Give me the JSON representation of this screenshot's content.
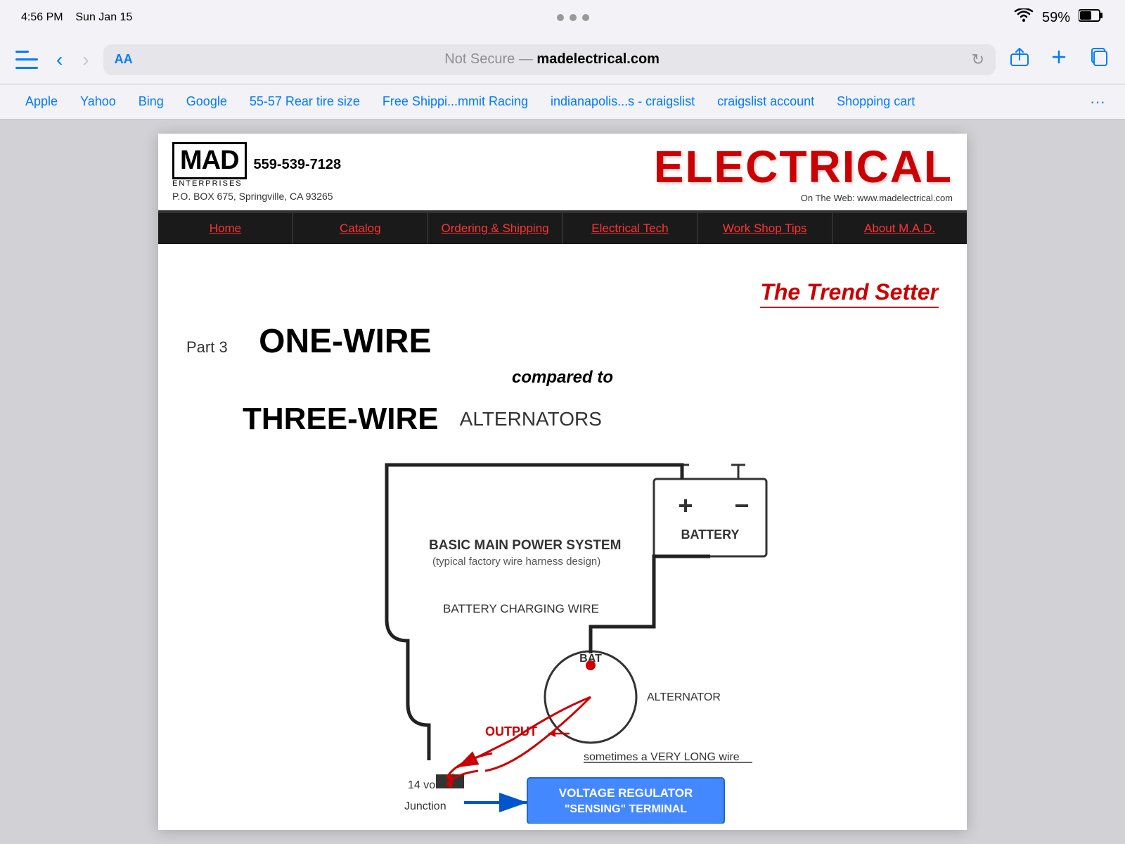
{
  "statusBar": {
    "time": "4:56 PM",
    "date": "Sun Jan 15",
    "battery": "59%"
  },
  "navBar": {
    "urlNotSecure": "Not Secure — ",
    "urlDomain": "madelectrical.com",
    "aaLabel": "AA"
  },
  "bookmarks": {
    "items": [
      {
        "label": "Apple"
      },
      {
        "label": "Yahoo"
      },
      {
        "label": "Bing"
      },
      {
        "label": "Google"
      },
      {
        "label": "55-57 Rear tire size"
      },
      {
        "label": "Free Shippi...mmit Racing"
      },
      {
        "label": "indianapolis...s - craigslist"
      },
      {
        "label": "craigslist account"
      },
      {
        "label": "Shopping cart"
      }
    ]
  },
  "site": {
    "logo": {
      "brand": "MAD",
      "enterprises": "ENTERPRISES",
      "phone": "559-539-7128",
      "address": "P.O. BOX 675, Springville, CA 93265",
      "electrical": "ELECTRICAL",
      "webUrl": "On The Web: www.madelectrical.com"
    },
    "nav": [
      {
        "label": "Home"
      },
      {
        "label": "Catalog"
      },
      {
        "label": "Ordering & Shipping"
      },
      {
        "label": "Electrical Tech"
      },
      {
        "label": "Work Shop Tips"
      },
      {
        "label": "About M.A.D."
      }
    ],
    "article": {
      "trendSetter": "The Trend Setter",
      "partLabel": "Part 3",
      "oneWire": "ONE-WIRE",
      "comparedTo": "compared to",
      "threeWire": "THREE-WIRE",
      "alternators": "ALTERNATORS",
      "diagramTitle": "BASIC MAIN POWER SYSTEM",
      "diagramSubtitle": "(typical factory wire harness design)",
      "batteryCharging": "BATTERY CHARGING WIRE",
      "battery": "BATTERY",
      "bat": "BAT",
      "alternator": "ALTERNATOR",
      "output": "OUTPUT",
      "veryLong": "sometimes a VERY LONG wire",
      "volts": "14 volts",
      "junction": "Junction",
      "voltageRegulator": "VOLTAGE REGULATOR",
      "sensing": "\"SENSING\" TERMINAL"
    }
  }
}
